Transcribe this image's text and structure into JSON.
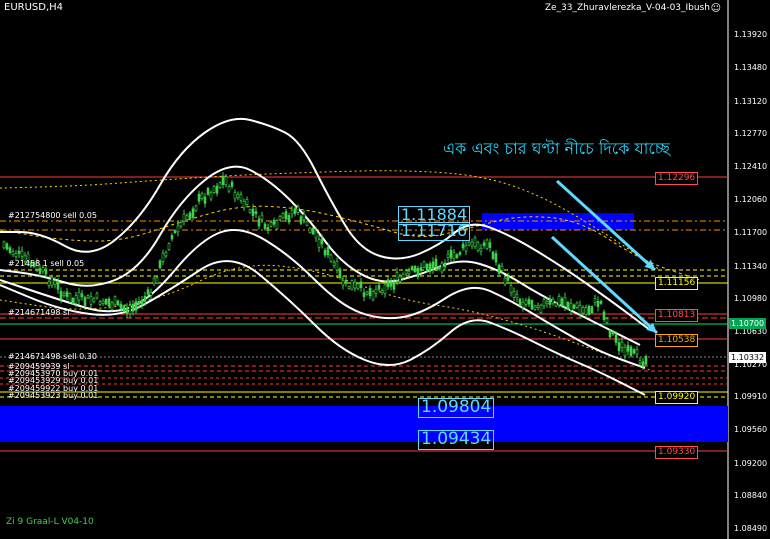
{
  "window": {
    "symbol": "EURUSD,H4",
    "indicator_name": "Ze_33_Zhuravlerezka_V-04-03_Ibush",
    "smiley": "☺",
    "footer": "Zi 9 Graal-L V04-10"
  },
  "annotation_text": "এক এবং চার ঘণ্টা নীচে দিকে যাচ্ছে",
  "price_axis": [
    "1.13920",
    "1.13480",
    "1.13120",
    "1.12770",
    "1.12410",
    "1.12060",
    "1.11700",
    "1.11340",
    "1.10980",
    "1.10630",
    "1.10270",
    "1.09910",
    "1.09560",
    "1.09200",
    "1.08840",
    "1.08490"
  ],
  "current_price": {
    "value": "1.10332",
    "color": "#ffffff"
  },
  "green_price": {
    "value": "1.10700",
    "color": "#00a651"
  },
  "right_tags": [
    {
      "value": "1.12296",
      "color": "#ff4d4d"
    },
    {
      "value": "1.11156",
      "color": "#ffff00"
    },
    {
      "value": "1.10813",
      "color": "#ff4d4d"
    },
    {
      "value": "1.10538",
      "color": "#ffa500"
    },
    {
      "value": "1.09920",
      "color": "#ffff00"
    },
    {
      "value": "1.09330",
      "color": "#ff4d4d"
    }
  ],
  "boxed_levels": {
    "upper_a": "1.11884",
    "upper_b": "1.11716",
    "lower_a": "1.09804",
    "lower_b": "1.09434"
  },
  "order_labels": {
    "top": "#212754800 sell 0.05",
    "mid1": "#21458 1 sell 0.05",
    "mid2": "#214671498 sl",
    "low_head": "#214671498 sell 0.30",
    "stack": [
      "#209459939 sl",
      "#209453970 buy 0.01",
      "#209453929 buy 0.01",
      "#209459922 buy 0.01",
      "#209453923 buy 0.01"
    ]
  },
  "colors": {
    "background": "#000000",
    "blue_zone": "#0000ff",
    "arrow": "#5fd9ff",
    "candles": "#3fd14c"
  }
}
